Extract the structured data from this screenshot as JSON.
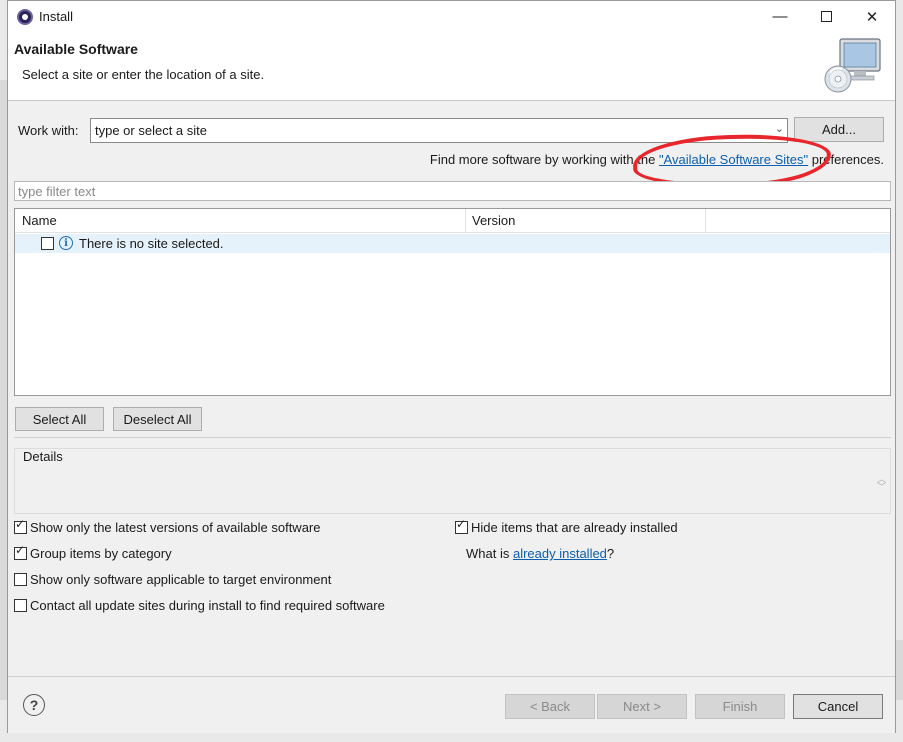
{
  "window": {
    "title": "Install",
    "minimize_glyph": "—",
    "close_glyph": "✕"
  },
  "header": {
    "title": "Available Software",
    "description": "Select a site or enter the location of a site."
  },
  "work_with": {
    "label": "Work with:",
    "value": "type or select a site",
    "arrow_glyph": "⌄",
    "add_label": "Add..."
  },
  "find_more": {
    "prefix": "Find more software by working with the ",
    "link": "\"Available Software Sites\"",
    "suffix": " preferences."
  },
  "filter": {
    "placeholder": "type filter text"
  },
  "table": {
    "columns": [
      "Name",
      "Version"
    ],
    "rows": [
      {
        "text": "There is no site selected.",
        "checked": false,
        "icon": "info-icon"
      }
    ]
  },
  "selection_buttons": {
    "select_all": "Select All",
    "deselect_all": "Deselect All"
  },
  "details": {
    "label": "Details"
  },
  "options": {
    "latest_versions": {
      "label": "Show only the latest versions of available software",
      "checked": true
    },
    "group_by_category": {
      "label": "Group items by category",
      "checked": true
    },
    "applicable_only": {
      "label": "Show only software applicable to target environment",
      "checked": false
    },
    "contact_all_sites": {
      "label": "Contact all update sites during install to find required software",
      "checked": false
    },
    "hide_installed": {
      "label": "Hide items that are already installed",
      "checked": true
    },
    "what_is_prefix": "What is ",
    "already_installed_link": "already installed",
    "what_is_suffix": "?"
  },
  "footer": {
    "help_glyph": "?",
    "back": "< Back",
    "next": "Next >",
    "finish": "Finish",
    "cancel": "Cancel"
  },
  "colors": {
    "link": "#0b5fb0",
    "annotation_ring": "#e8262c",
    "row_highlight": "#e5f1fb"
  }
}
